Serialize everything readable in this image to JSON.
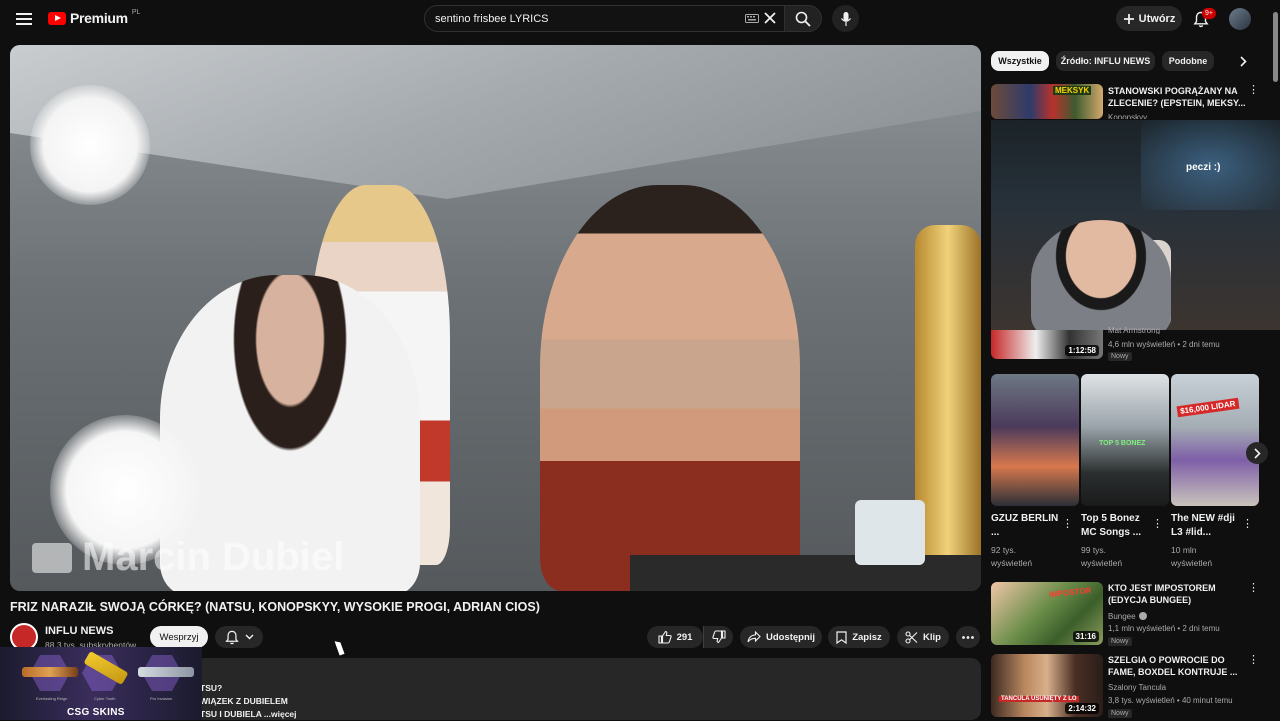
{
  "header": {
    "logo_text": "Premium",
    "logo_country": "PL",
    "search_value": "sentino frisbee LYRICS",
    "create_label": "Utwórz",
    "notifications_badge": "9+",
    "icons": [
      "menu-icon",
      "keyboard-icon",
      "clear-icon",
      "search-icon",
      "mic-icon",
      "plus-icon",
      "bell-icon"
    ]
  },
  "player": {
    "watermark": "Marcin Dubiel"
  },
  "video": {
    "title": "FRIZ NARAZIŁ SWOJĄ CÓRKĘ? (NATSU, KONOPSKYY, WYSOKIE PROGI, ADRIAN CIOS)",
    "channel_name": "INFLU NEWS",
    "subscribers": "88,3 tys. subskrybentów",
    "support_label": "Wesprzyj",
    "likes": "291",
    "share_label": "Udostępnij",
    "save_label": "Zapisz",
    "clip_label": "Klip",
    "description_lines": [
      "TSU?",
      "WIĄZEK Z DUBIELEM",
      "TSU I DUBIELA"
    ],
    "more_label": "...więcej"
  },
  "overlay": {
    "brand": "CSG   SKINS",
    "captions": [
      "Everlasting Reign",
      "Cyber Tooth",
      "Pro Invasion"
    ]
  },
  "sidebar": {
    "chips": [
      "Wszystkie",
      "Źródło: INFLU NEWS",
      "Podobne"
    ],
    "videos": [
      {
        "title": "STANOWSKI POGRĄŻANY NA ZLECENIE? (EPSTEIN, MEKSY...",
        "channel": "Konopskyy",
        "thumb_text": "MEKSYK"
      },
      {
        "channel": "Mat Armstrong",
        "meta": "4,6 mln wyświetleń • 2 dni temu",
        "badge": "Nowy",
        "duration": "1:12:58"
      },
      {
        "title": "KTO JEST IMPOSTOREM (EDYCJA BUNGEE)",
        "channel": "Bungee",
        "meta": "1,1 mln wyświetleń • 2 dni temu",
        "badge": "Nowy",
        "duration": "31:16",
        "thumb_text": "IMPOSTOR"
      },
      {
        "title": "SZELGIA O POWROCIE DO FAME, BOXDEL KONTRUJE ...",
        "channel": "Szalony Tancula",
        "meta": "3,8 tys. wyświetleń • 40 minut temu",
        "badge": "Nowy",
        "duration": "2:14:32",
        "thumb_text": "TANCULA USUNIĘTY Z LO"
      }
    ],
    "webcam_sign": "peczi :)",
    "shorts": [
      {
        "title": "GZUZ BERLIN ...",
        "views": "92 tys. wyświetleń"
      },
      {
        "title": "Top 5 Bonez MC Songs ...",
        "views": "99 tys. wyświetleń",
        "thumb_text": "TOP 5 BONEZ"
      },
      {
        "title": "The NEW #dji L3 #lid...",
        "views": "10 mln wyświetleń",
        "thumb_text": "$16,000 LIDAR"
      }
    ]
  },
  "colors": {
    "background": "#0f0f0f",
    "surface": "#272727",
    "accent_red": "#ff0000",
    "badge_red": "#cc0000",
    "text": "#f1f1f1",
    "muted": "#aaaaaa"
  }
}
